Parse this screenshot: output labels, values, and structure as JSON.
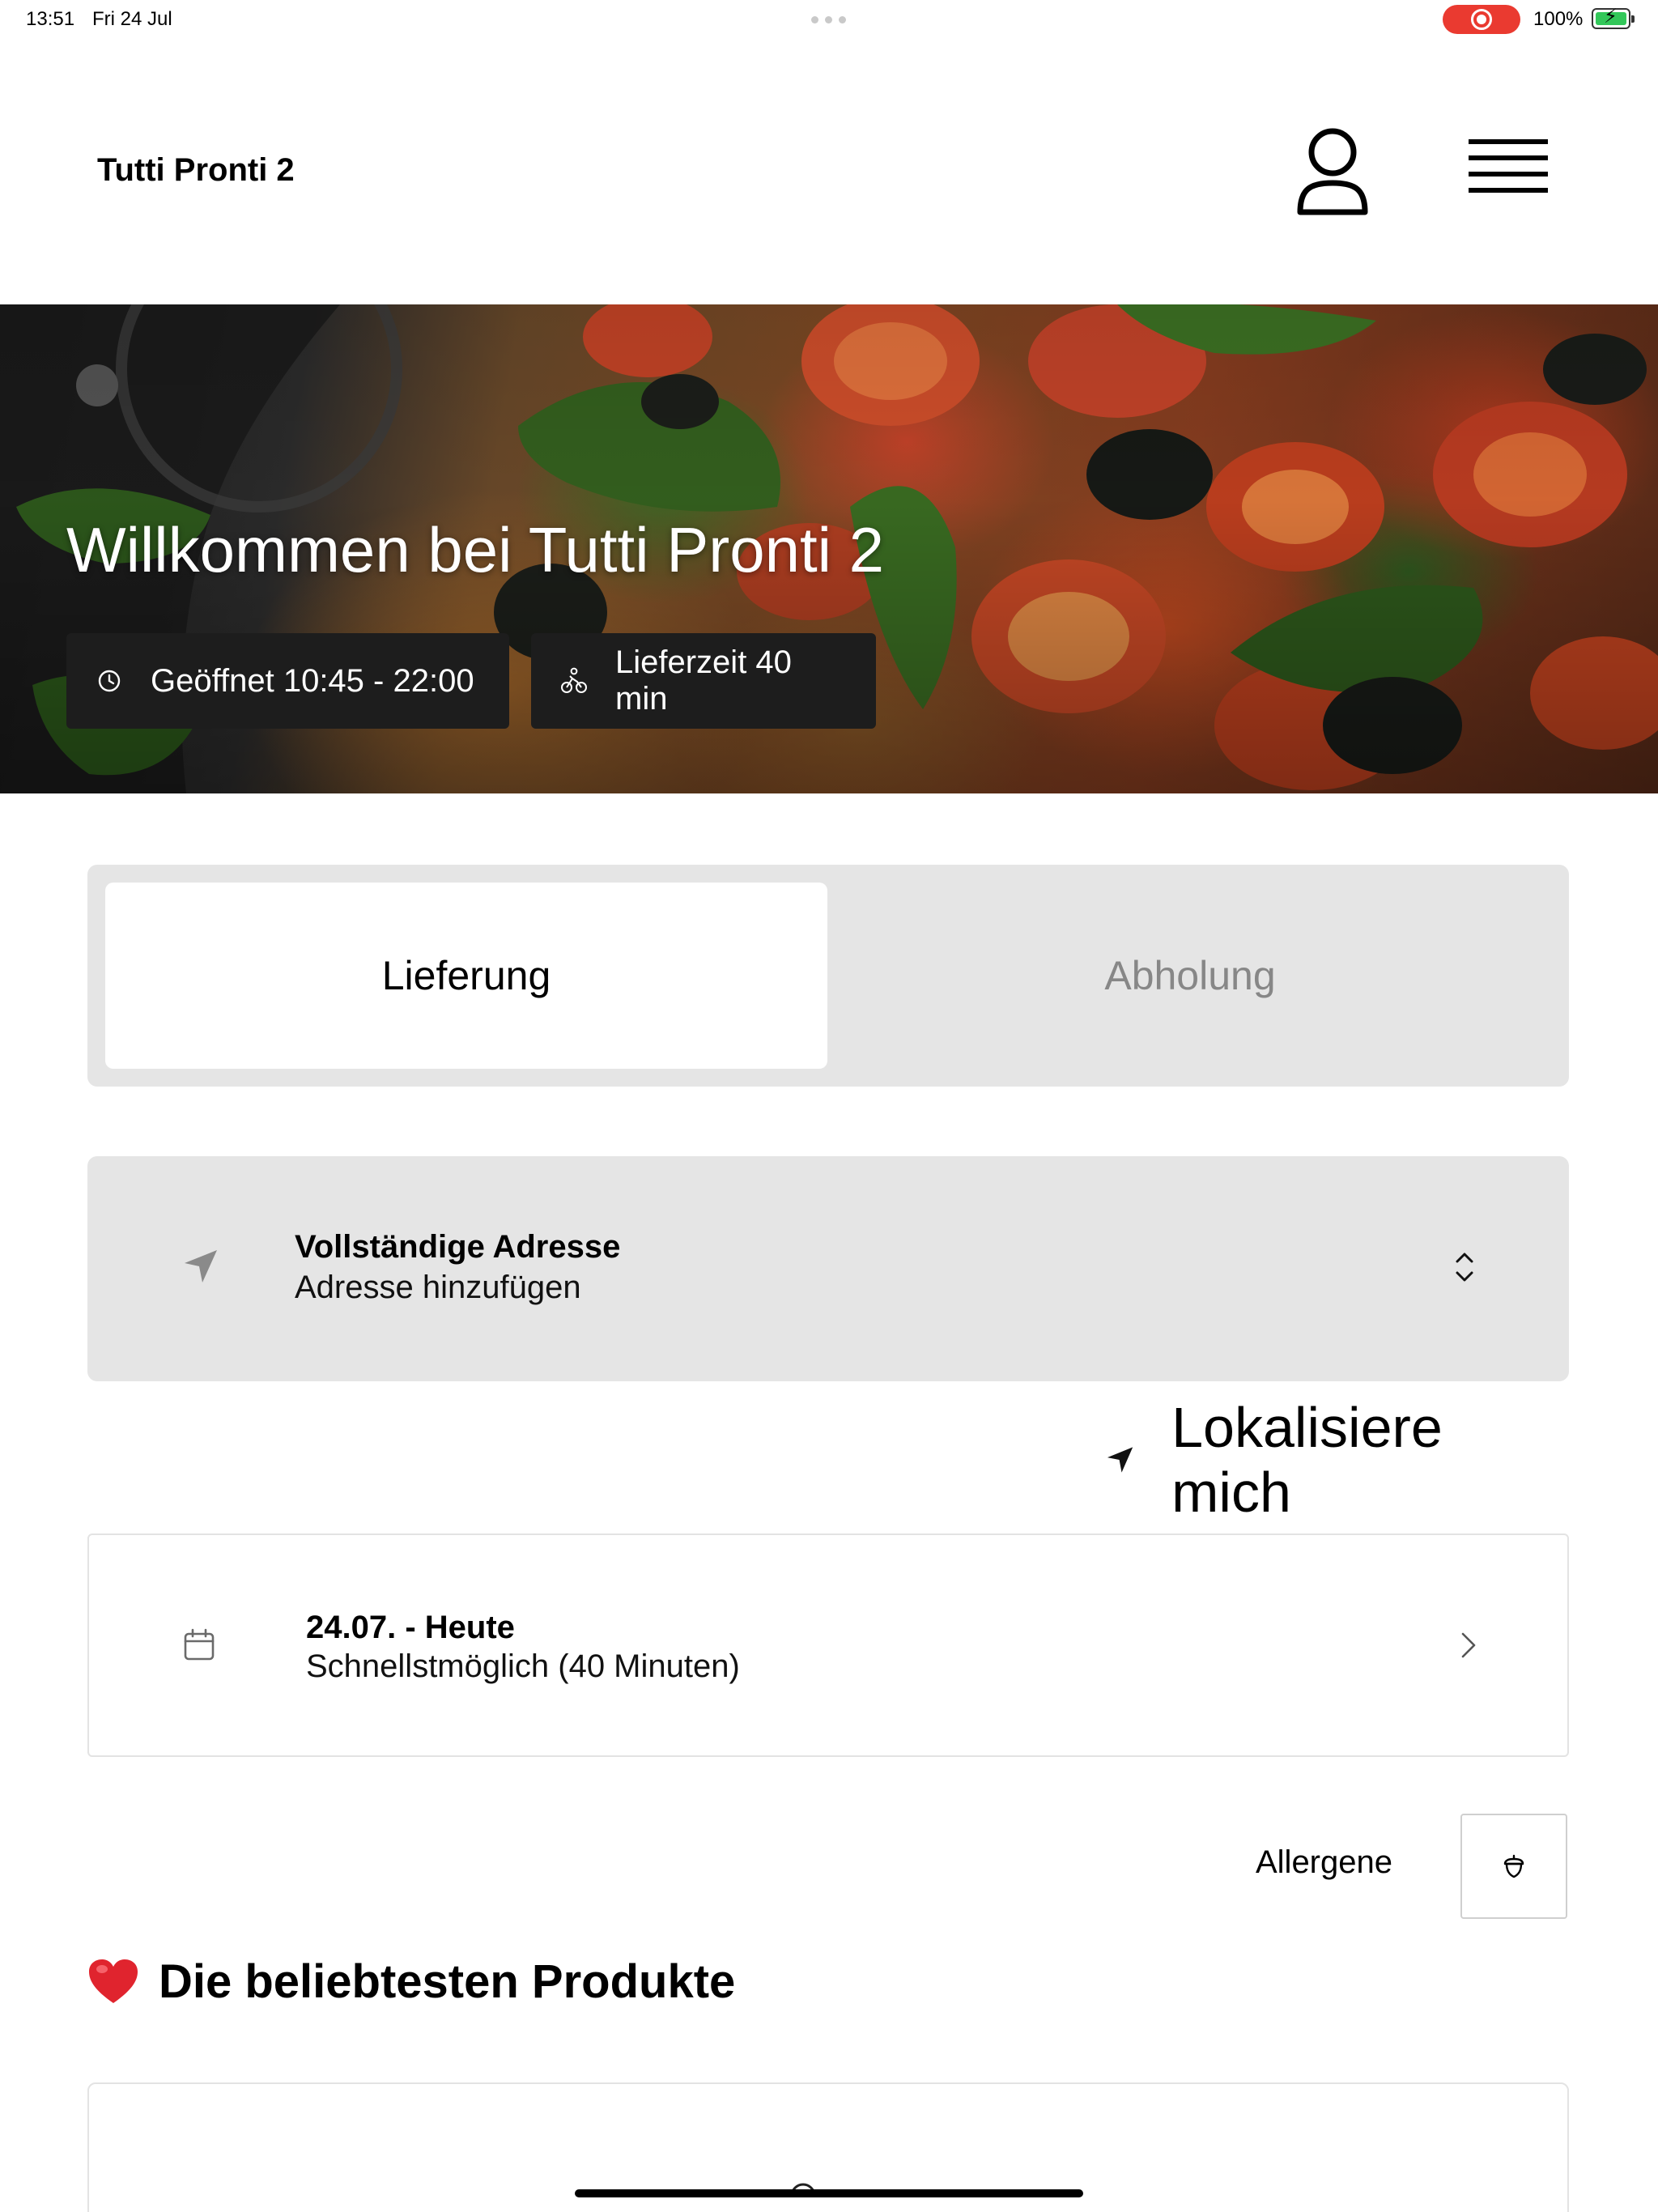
{
  "status_bar": {
    "time": "13:51",
    "date": "Fri 24 Jul",
    "battery": "100%",
    "battery_level": 1.0
  },
  "header": {
    "brand": "Tutti Pronti 2",
    "profile_icon": "user-icon",
    "menu_icon": "hamburger-menu-icon"
  },
  "hero": {
    "title": "Willkommen bei Tutti Pronti 2",
    "hours_label": "Geöffnet 10:45 - 22:00",
    "hours_icon": "clock-icon",
    "delivery_label": "Lieferzeit 40 min",
    "delivery_icon": "bicycle-courier-icon"
  },
  "order_mode": {
    "tabs": [
      {
        "label": "Lieferung",
        "active": true
      },
      {
        "label": "Abholung",
        "active": false
      }
    ]
  },
  "address": {
    "title": "Vollständige Adresse",
    "subtitle": "Adresse hinzufügen",
    "icon": "location-arrow-icon",
    "toggle_icon": "chevron-up-down-icon"
  },
  "locate": {
    "label": "Lokalisiere mich",
    "icon": "location-arrow-icon"
  },
  "schedule": {
    "title": "24.07. - Heute",
    "subtitle": "Schnellstmöglich (40 Minuten)",
    "icon": "calendar-icon",
    "action_icon": "chevron-right-icon"
  },
  "allergens": {
    "label": "Allergene",
    "icon": "acorn-icon"
  },
  "popular": {
    "heading": "Die beliebtesten Produkte",
    "icon": "heart-emoji-icon"
  },
  "colors": {
    "segment_bg": "#e5e5e5",
    "inactive_text": "#878787",
    "pill_bg": "#1d1d1d",
    "record_red": "#ea3a30",
    "battery_green": "#32c759",
    "heart_red": "#e0242e"
  }
}
